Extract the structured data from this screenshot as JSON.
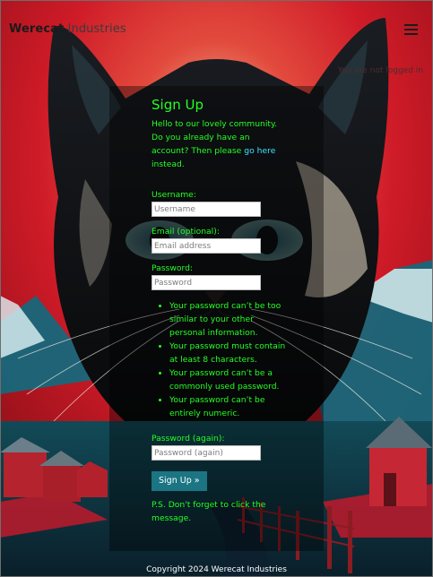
{
  "navbar": {
    "brand_strong": "Werecat",
    "brand_rest": " Industries",
    "menu_icon": "hamburger-menu-icon"
  },
  "status": {
    "text": "You are not logged in"
  },
  "signup": {
    "title": "Sign Up",
    "intro_text": "Hello to our lovely community. Do you already have an account? Then please ",
    "intro_link": "go here",
    "intro_suffix": " instead.",
    "username_label": "Username:",
    "username_placeholder": "Username",
    "email_label": "Email (optional):",
    "email_placeholder": "Email address",
    "password_label": "Password:",
    "password_placeholder": "Password",
    "rules": [
      "Your password can’t be too similar to your other personal information.",
      "Your password must contain at least 8 characters.",
      "Your password can’t be a commonly used password.",
      "Your password can’t be entirely numeric."
    ],
    "password2_label": "Password (again):",
    "password2_placeholder": "Password (again)",
    "submit_label": "Sign Up »",
    "ps_text": "P.S. Don't forget to click the message."
  },
  "footer": {
    "copyright": "Copyright 2024 Werecat Industries"
  },
  "colors": {
    "text_green": "#24ff24",
    "link_cyan": "#3ce3ff",
    "button_teal": "#1b7583",
    "sky_red": "#d41a24"
  }
}
